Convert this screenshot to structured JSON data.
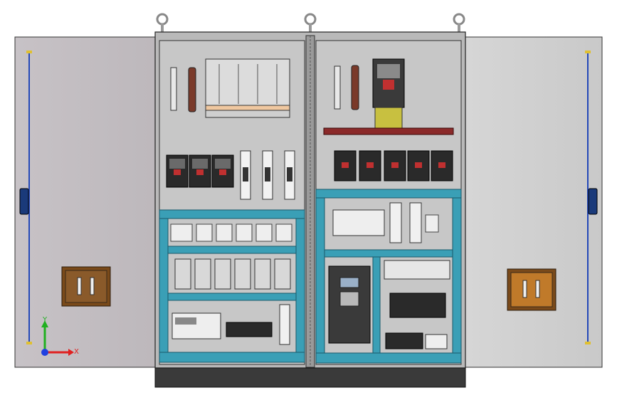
{
  "viewport": {
    "title": "",
    "triad": {
      "x_label": "X",
      "y_label": "Y"
    }
  },
  "colors": {
    "background": "#ffffff",
    "door_left": "#c8c3c7",
    "door_right": "#cfcfcf",
    "cabinet_frame": "#b7b7b7",
    "mounting_plate": "#c9c9c9",
    "duct_teal": "#3a9fb6",
    "busbar_red": "#8b2a2a",
    "plinth": "#3a3a3a",
    "handle_brown": "#7a4a1a",
    "hinge_rod": "#2348b8",
    "axis_x": "#e02020",
    "axis_y": "#20b020",
    "axis_z": "#2040e0"
  },
  "cabinet": {
    "left_section": {
      "breakers_count": 3,
      "fuse_holders_count": 3,
      "terminal_rows": 3
    },
    "right_section": {
      "outgoing_breakers_count": 5,
      "has_vfd": true
    }
  }
}
